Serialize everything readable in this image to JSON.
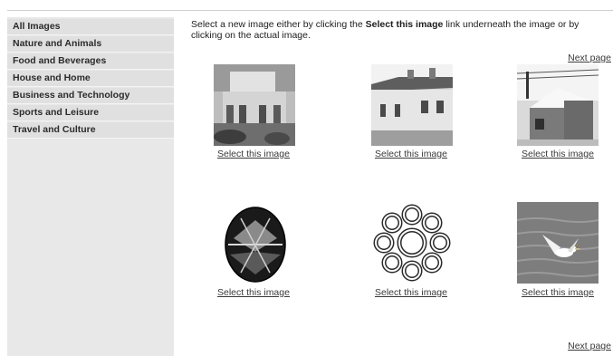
{
  "sidebar": {
    "items": [
      {
        "label": "All Images"
      },
      {
        "label": "Nature and Animals"
      },
      {
        "label": "Food and Beverages"
      },
      {
        "label": "House and Home"
      },
      {
        "label": "Business and Technology"
      },
      {
        "label": "Sports and Leisure"
      },
      {
        "label": "Travel and Culture"
      }
    ]
  },
  "main": {
    "instructions_pre": "Select a new image either by clicking the ",
    "instructions_bold": "Select this image",
    "instructions_post": " link underneath the image or by clicking on the actual image.",
    "next_page_label": "Next page",
    "select_label": "Select this image",
    "images": [
      {
        "icon": "modern-building-photo"
      },
      {
        "icon": "row-houses-photo"
      },
      {
        "icon": "snowy-barn-photo"
      },
      {
        "icon": "painted-egg-image"
      },
      {
        "icon": "knot-ornament-image"
      },
      {
        "icon": "seagull-photo"
      }
    ]
  }
}
